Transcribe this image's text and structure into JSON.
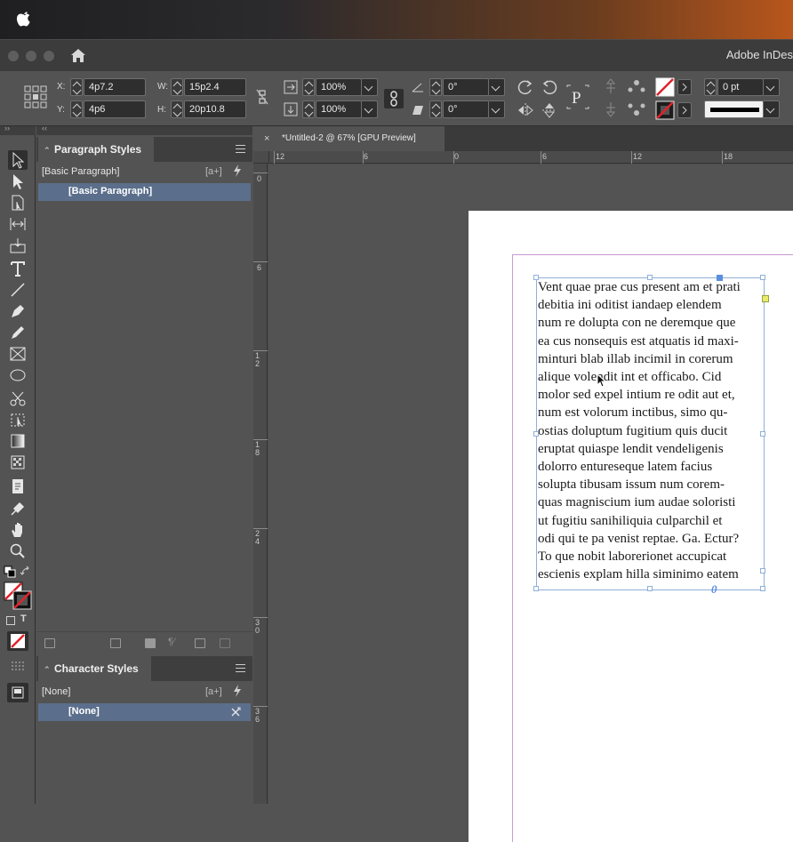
{
  "app": {
    "title": "Adobe InDes"
  },
  "control_bar": {
    "x_label": "X:",
    "x_value": "4p7.2",
    "y_label": "Y:",
    "y_value": "4p6",
    "w_label": "W:",
    "w_value": "15p2.4",
    "h_label": "H:",
    "h_value": "20p10.8",
    "scale_x": "100%",
    "scale_y": "100%",
    "rotate": "0°",
    "shear": "0°",
    "stroke_weight": "0 pt"
  },
  "paragraph_styles": {
    "title": "Paragraph Styles",
    "current": "[Basic Paragraph]",
    "new_style_glyph": "[a+]",
    "items": [
      "[Basic Paragraph]"
    ]
  },
  "character_styles": {
    "title": "Character Styles",
    "current": "[None]",
    "new_style_glyph": "[a+]",
    "items": [
      "[None]"
    ]
  },
  "document": {
    "tab_title": "*Untitled-2 @ 67% [GPU Preview]",
    "close_glyph": "×",
    "h_ruler": [
      "12",
      "6",
      "0",
      "6",
      "12",
      "18"
    ],
    "v_ruler": [
      "0",
      "6",
      "1 2",
      "1 8",
      "2 4",
      "3 0",
      "3 6"
    ],
    "text_lines": [
      "Vent quae prae cus present am et prati",
      "debitia ini oditist iandaep elendem",
      "num re dolupta con ne deremque que",
      "ea cus nonsequis est atquatis id maxi-",
      "minturi blab illab incimil in corerum",
      "alique volendit int et officabo. Cid",
      "molor sed expel intium re odit aut et,",
      "num est volorum inctibus, simo qu-",
      "ostias doluptum fugitium quis ducit",
      "eruptat quiaspe lendit vendeligenis",
      "dolorro entureseque latem facius",
      "solupta tibusam issum num corem-",
      "quas magniscium ium audae soloristi",
      "ut fugitiu sanihiliquia culparchil et",
      "odi qui te pa venist reptae. Ga. Ectur?",
      "To que nobit laborerionet accupicat",
      "escienis explam hilla siminimo eatem"
    ],
    "overset_glyph": "0"
  },
  "colors": {
    "selection_row": "#5b6f8c",
    "frame_edge": "#8fb0d9",
    "margin_guide": "#c79ad1"
  }
}
